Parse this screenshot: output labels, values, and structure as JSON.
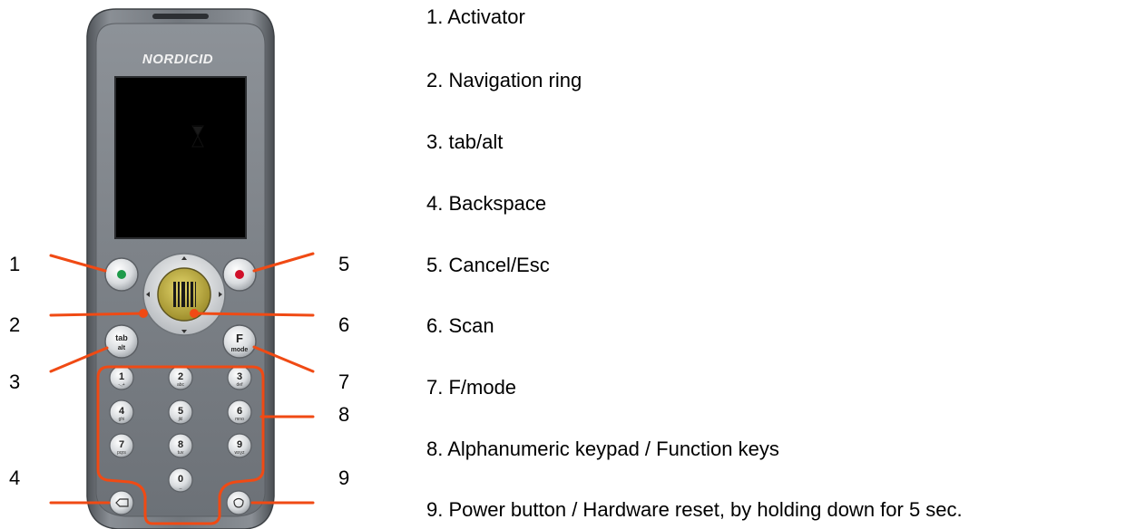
{
  "device": {
    "brand": "NORDICID",
    "keys": {
      "tab_top": "tab",
      "tab_bottom": "alt",
      "f_top": "F",
      "f_bottom": "mode",
      "keypad": [
        {
          "digit": "1",
          "letters": "-.,+"
        },
        {
          "digit": "2",
          "letters": "abc"
        },
        {
          "digit": "3",
          "letters": "def"
        },
        {
          "digit": "4",
          "letters": "ghi"
        },
        {
          "digit": "5",
          "letters": "jkl"
        },
        {
          "digit": "6",
          "letters": "mno"
        },
        {
          "digit": "7",
          "letters": "pqrs"
        },
        {
          "digit": "8",
          "letters": "tuv"
        },
        {
          "digit": "9",
          "letters": "wxyz"
        },
        {
          "digit": "0",
          "letters": "_"
        }
      ]
    }
  },
  "callouts": {
    "left": [
      "1",
      "2",
      "3",
      "4"
    ],
    "right": [
      "5",
      "6",
      "7",
      "8",
      "9"
    ]
  },
  "legend": [
    "1. Activator",
    "2. Navigation ring",
    "3. tab/alt",
    "4. Backspace",
    "5. Cancel/Esc",
    "6. Scan",
    "7. F/mode",
    "8. Alphanumeric keypad / Function keys",
    "9. Power button / Hardware reset, by holding down for 5 sec."
  ],
  "colors": {
    "callout_line": "#f04a14",
    "device_body": "#6b7076",
    "screen": "#000000",
    "activator_dot": "#1e9a4a",
    "cancel_dot": "#d0102a",
    "scan_button": "#c9b84a"
  }
}
